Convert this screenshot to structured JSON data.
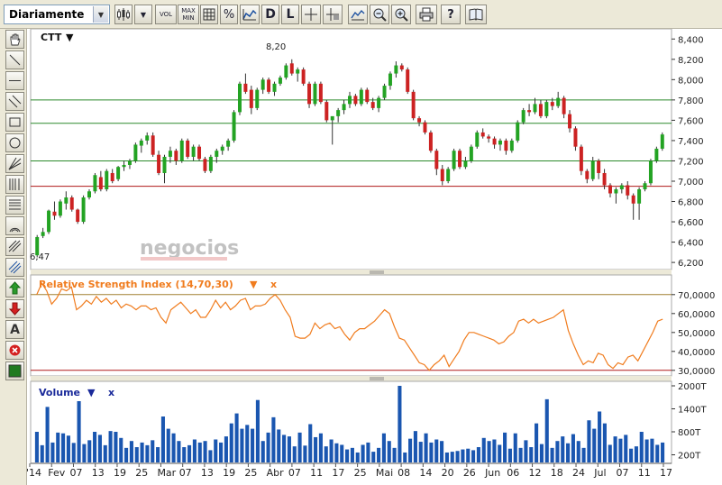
{
  "toolbar": {
    "period_value": "Diariamente",
    "vol_label": "VOL",
    "maxmin_top": "MAX",
    "maxmin_bottom": "MIN",
    "percent_label": "%",
    "d_label": "D",
    "l_label": "L",
    "help_label": "?"
  },
  "price_panel": {
    "symbol": "CTT",
    "menu_arrow": "▼",
    "y_ticks": [
      "8,400",
      "8,200",
      "8,000",
      "7,800",
      "7,600",
      "7,400",
      "7,200",
      "7,000",
      "6,800",
      "6,600",
      "6,400",
      "6,200"
    ],
    "y_range": [
      6.13,
      8.5
    ],
    "max_label": "8,20",
    "min_label": "6,47",
    "watermark": "negocios",
    "green_lines": [
      7.8,
      7.57,
      7.2
    ],
    "red_line": 6.95,
    "colors": {
      "up": "#23a323",
      "down": "#cc2222",
      "green_line": "#2b8a2b",
      "red_line": "#b01818"
    }
  },
  "rsi_panel": {
    "title": "Relative Strength Index (14,70,30)",
    "menu_arrow": "▼",
    "close_label": "x",
    "y_ticks": [
      "70,0000",
      "60,0000",
      "50,0000",
      "40,0000",
      "30,0000"
    ],
    "y_range": [
      28,
      78
    ],
    "upper_threshold": 70,
    "lower_threshold": 30,
    "line_color": "#f07c1e"
  },
  "volume_panel": {
    "title": "Volume",
    "menu_arrow": "▼",
    "close_label": "x",
    "y_ticks": [
      "2000T",
      "1400T",
      "800T",
      "200T"
    ],
    "bar_color": "#1a56b0"
  },
  "x_axis_labels": [
    "'14",
    "Fev",
    "07",
    "13",
    "19",
    "25",
    "Mar",
    "07",
    "13",
    "19",
    "25",
    "Abr",
    "07",
    "11",
    "17",
    "25",
    "Mai",
    "08",
    "14",
    "20",
    "26",
    "Jun",
    "06",
    "12",
    "18",
    "24",
    "Jul",
    "07",
    "11",
    "17"
  ],
  "chart_data": {
    "type": "candlestick",
    "series": [
      {
        "name": "CTT",
        "values": [
          [
            6.27,
            6.47,
            6.25,
            6.45
          ],
          [
            6.46,
            6.54,
            6.44,
            6.5
          ],
          [
            6.5,
            6.72,
            6.48,
            6.71
          ],
          [
            6.7,
            6.8,
            6.62,
            6.66
          ],
          [
            6.66,
            6.82,
            6.64,
            6.8
          ],
          [
            6.78,
            6.9,
            6.72,
            6.84
          ],
          [
            6.84,
            6.86,
            6.7,
            6.72
          ],
          [
            6.72,
            6.73,
            6.58,
            6.6
          ],
          [
            6.6,
            6.86,
            6.58,
            6.84
          ],
          [
            6.84,
            6.92,
            6.82,
            6.9
          ],
          [
            6.9,
            7.08,
            6.88,
            7.06
          ],
          [
            7.04,
            7.1,
            6.9,
            6.92
          ],
          [
            6.92,
            7.12,
            6.9,
            7.1
          ],
          [
            7.08,
            7.12,
            6.98,
            7.0
          ],
          [
            7.02,
            7.15,
            7.0,
            7.14
          ],
          [
            7.14,
            7.2,
            7.1,
            7.16
          ],
          [
            7.16,
            7.22,
            7.12,
            7.2
          ],
          [
            7.2,
            7.38,
            7.18,
            7.36
          ],
          [
            7.35,
            7.42,
            7.28,
            7.4
          ],
          [
            7.4,
            7.48,
            7.36,
            7.45
          ],
          [
            7.45,
            7.48,
            7.24,
            7.26
          ],
          [
            7.26,
            7.3,
            7.06,
            7.08
          ],
          [
            7.08,
            7.26,
            6.98,
            7.24
          ],
          [
            7.24,
            7.34,
            7.18,
            7.3
          ],
          [
            7.3,
            7.32,
            7.16,
            7.2
          ],
          [
            7.2,
            7.42,
            7.18,
            7.4
          ],
          [
            7.4,
            7.42,
            7.22,
            7.24
          ],
          [
            7.24,
            7.36,
            7.2,
            7.34
          ],
          [
            7.34,
            7.36,
            7.2,
            7.22
          ],
          [
            7.22,
            7.24,
            7.08,
            7.1
          ],
          [
            7.1,
            7.26,
            7.08,
            7.24
          ],
          [
            7.24,
            7.32,
            7.18,
            7.3
          ],
          [
            7.3,
            7.36,
            7.26,
            7.34
          ],
          [
            7.34,
            7.42,
            7.3,
            7.4
          ],
          [
            7.4,
            7.7,
            7.38,
            7.68
          ],
          [
            7.68,
            7.98,
            7.65,
            7.96
          ],
          [
            7.96,
            8.06,
            7.86,
            7.88
          ],
          [
            7.9,
            7.94,
            7.66,
            7.72
          ],
          [
            7.72,
            7.92,
            7.7,
            7.9
          ],
          [
            7.9,
            8.02,
            7.86,
            8.0
          ],
          [
            8.0,
            8.02,
            7.86,
            7.88
          ],
          [
            7.88,
            7.98,
            7.84,
            7.96
          ],
          [
            7.96,
            8.04,
            7.94,
            8.02
          ],
          [
            8.02,
            8.16,
            8.0,
            8.14
          ],
          [
            8.16,
            8.2,
            8.04,
            8.06
          ],
          [
            8.06,
            8.12,
            7.98,
            8.1
          ],
          [
            8.1,
            8.12,
            7.94,
            7.96
          ],
          [
            7.96,
            7.98,
            7.72,
            7.76
          ],
          [
            7.76,
            7.98,
            7.74,
            7.96
          ],
          [
            7.96,
            7.98,
            7.76,
            7.78
          ],
          [
            7.78,
            7.8,
            7.58,
            7.6
          ],
          [
            7.6,
            7.62,
            7.36,
            7.64
          ],
          [
            7.64,
            7.72,
            7.58,
            7.7
          ],
          [
            7.7,
            7.8,
            7.66,
            7.76
          ],
          [
            7.76,
            7.88,
            7.72,
            7.84
          ],
          [
            7.84,
            7.86,
            7.74,
            7.76
          ],
          [
            7.76,
            7.92,
            7.74,
            7.9
          ],
          [
            7.9,
            7.92,
            7.76,
            7.78
          ],
          [
            7.78,
            7.82,
            7.7,
            7.72
          ],
          [
            7.72,
            7.84,
            7.68,
            7.82
          ],
          [
            7.82,
            7.96,
            7.8,
            7.94
          ],
          [
            7.94,
            8.08,
            7.9,
            8.06
          ],
          [
            8.06,
            8.18,
            8.02,
            8.14
          ],
          [
            8.14,
            8.16,
            8.08,
            8.1
          ],
          [
            8.1,
            8.12,
            7.86,
            7.88
          ],
          [
            7.88,
            7.9,
            7.6,
            7.62
          ],
          [
            7.62,
            7.64,
            7.54,
            7.58
          ],
          [
            7.58,
            7.6,
            7.46,
            7.48
          ],
          [
            7.48,
            7.5,
            7.28,
            7.3
          ],
          [
            7.3,
            7.32,
            7.06,
            7.12
          ],
          [
            7.12,
            7.16,
            6.96,
            7.0
          ],
          [
            7.0,
            7.14,
            6.98,
            7.12
          ],
          [
            7.12,
            7.32,
            7.1,
            7.3
          ],
          [
            7.3,
            7.32,
            7.12,
            7.14
          ],
          [
            7.14,
            7.24,
            7.12,
            7.2
          ],
          [
            7.2,
            7.36,
            7.18,
            7.34
          ],
          [
            7.34,
            7.5,
            7.32,
            7.48
          ],
          [
            7.48,
            7.52,
            7.42,
            7.44
          ],
          [
            7.44,
            7.46,
            7.38,
            7.42
          ],
          [
            7.42,
            7.44,
            7.32,
            7.36
          ],
          [
            7.36,
            7.42,
            7.3,
            7.4
          ],
          [
            7.4,
            7.42,
            7.26,
            7.3
          ],
          [
            7.3,
            7.42,
            7.28,
            7.4
          ],
          [
            7.4,
            7.6,
            7.38,
            7.58
          ],
          [
            7.58,
            7.72,
            7.56,
            7.7
          ],
          [
            7.7,
            7.76,
            7.64,
            7.68
          ],
          [
            7.68,
            7.82,
            7.66,
            7.76
          ],
          [
            7.76,
            7.8,
            7.62,
            7.64
          ],
          [
            7.64,
            7.8,
            7.62,
            7.78
          ],
          [
            7.78,
            7.82,
            7.7,
            7.74
          ],
          [
            7.74,
            7.88,
            7.72,
            7.82
          ],
          [
            7.82,
            7.84,
            7.62,
            7.66
          ],
          [
            7.66,
            7.7,
            7.48,
            7.52
          ],
          [
            7.52,
            7.54,
            7.3,
            7.34
          ],
          [
            7.34,
            7.36,
            7.06,
            7.1
          ],
          [
            7.1,
            7.12,
            6.98,
            7.02
          ],
          [
            7.02,
            7.24,
            7.0,
            7.2
          ],
          [
            7.2,
            7.22,
            7.02,
            7.08
          ],
          [
            7.08,
            7.12,
            6.92,
            6.96
          ],
          [
            6.96,
            6.98,
            6.84,
            6.88
          ],
          [
            6.88,
            6.94,
            6.78,
            6.92
          ],
          [
            6.92,
            6.98,
            6.88,
            6.96
          ],
          [
            6.96,
            7.0,
            6.82,
            6.86
          ],
          [
            6.86,
            6.88,
            6.62,
            6.78
          ],
          [
            6.78,
            6.94,
            6.62,
            6.92
          ],
          [
            6.92,
            7.0,
            6.9,
            6.98
          ],
          [
            6.98,
            7.22,
            6.96,
            7.2
          ],
          [
            7.2,
            7.34,
            7.18,
            7.32
          ],
          [
            7.32,
            7.48,
            7.3,
            7.46
          ]
        ]
      },
      {
        "name": "Relative Strength Index (14,70,30)",
        "values": [
          70,
          76,
          72,
          65,
          68,
          73,
          72,
          74,
          62,
          64,
          67,
          65,
          69,
          66,
          68,
          65,
          67,
          63,
          65,
          64,
          62,
          64,
          64,
          62,
          63,
          58,
          55,
          62,
          64,
          66,
          63,
          60,
          62,
          58,
          58,
          62,
          67,
          63,
          66,
          62,
          64,
          67,
          68,
          62,
          64,
          64,
          65,
          68,
          70,
          67,
          62,
          58,
          48,
          47,
          47,
          49,
          55,
          52,
          54,
          55,
          52,
          53,
          49,
          46,
          50,
          52,
          52,
          54,
          56,
          59,
          62,
          60,
          53,
          47,
          46,
          42,
          38,
          34,
          33,
          30,
          33,
          35,
          38,
          32,
          36,
          40,
          46,
          50,
          50,
          49,
          48,
          47,
          46,
          44,
          45,
          48,
          50,
          56,
          57,
          55,
          57,
          55,
          56,
          57,
          58,
          60,
          62,
          51,
          44,
          38,
          33,
          35,
          34,
          39,
          38,
          33,
          31,
          34,
          33,
          37,
          38,
          35,
          40,
          45,
          50,
          56,
          57
        ]
      },
      {
        "name": "Volume",
        "values": [
          800,
          450,
          1450,
          520,
          780,
          760,
          700,
          510,
          1600,
          480,
          580,
          800,
          720,
          450,
          820,
          800,
          640,
          380,
          560,
          400,
          520,
          450,
          580,
          400,
          1200,
          880,
          760,
          560,
          400,
          450,
          600,
          520,
          560,
          320,
          600,
          520,
          680,
          1020,
          1280,
          880,
          980,
          880,
          1630,
          560,
          780,
          1180,
          860,
          720,
          680,
          420,
          780,
          440,
          1000,
          660,
          760,
          420,
          600,
          500,
          460,
          340,
          380,
          260,
          460,
          520,
          280,
          380,
          760,
          560,
          380,
          2000,
          260,
          620,
          820,
          540,
          760,
          520,
          600,
          560,
          260,
          280,
          300,
          340,
          360,
          320,
          400,
          640,
          560,
          600,
          460,
          780,
          360,
          760,
          380,
          580,
          400,
          1020,
          480,
          1650,
          380,
          560,
          680,
          500,
          740,
          560,
          380,
          1100,
          880,
          1330,
          1020,
          460,
          680,
          620,
          720,
          360,
          420,
          800,
          600,
          620,
          460,
          520
        ]
      }
    ],
    "y_range": [
      6.13,
      8.5
    ],
    "xlabel": "",
    "ylabel": "",
    "grid": false,
    "legend": "top-left"
  }
}
